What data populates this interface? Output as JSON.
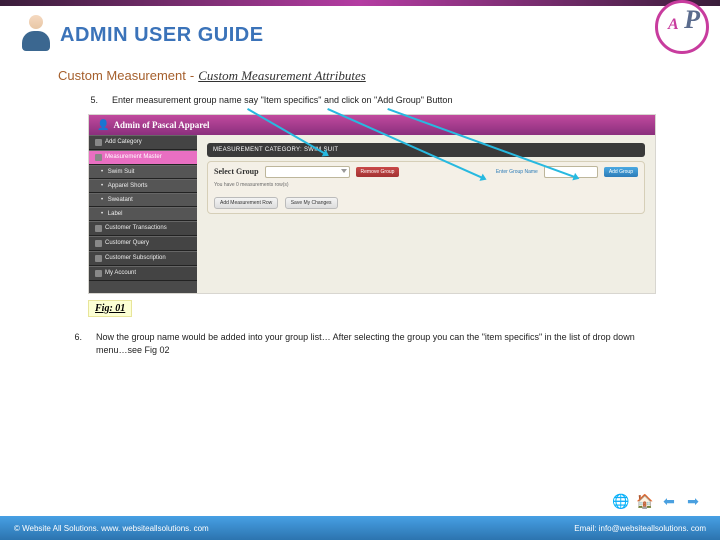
{
  "header": {
    "title": "ADMIN USER GUIDE"
  },
  "breadcrumb": {
    "main": "Custom Measurement",
    "sep": "-",
    "sub": "Custom Measurement Attributes"
  },
  "steps": {
    "s5": {
      "num": "5.",
      "text": "Enter measurement group name say \"Item specifics\" and click on \"Add Group\" Button"
    },
    "s6": {
      "num": "6.",
      "text": "Now the group name would be added into your group list… After selecting the group you can the \"item specifics\" in the list of drop down menu…see Fig 02"
    }
  },
  "shot": {
    "bar": "Admin of Pascal Apparel",
    "sidebar": [
      "Add Category",
      "Measurement Master",
      "Swim Suit",
      "Apparel Shorts",
      "Sweatant",
      "Label",
      "Customer Transactions",
      "Customer Query",
      "Customer Subscription",
      "My Account"
    ],
    "cat": "MEASUREMENT CATEGORY: SWIM SUIT",
    "sel_label": "Select Group",
    "dd_placeholder": " ",
    "btn_remove": "Remove Group",
    "enter_hint": "Enter Group Name",
    "btn_add": "Add Group",
    "count": "You have 0 measurements row(s)",
    "btn_row": "Add Measurement Row",
    "btn_save": "Save My Changes"
  },
  "caption": "Fig: 01",
  "nav": {
    "world": "🌐",
    "home": "🏠",
    "prev": "⬅",
    "next": "➡"
  },
  "footer": {
    "left": "© Website All Solutions. www. websiteallsolutions. com",
    "right": "Email: info@websiteallsolutions. com"
  }
}
